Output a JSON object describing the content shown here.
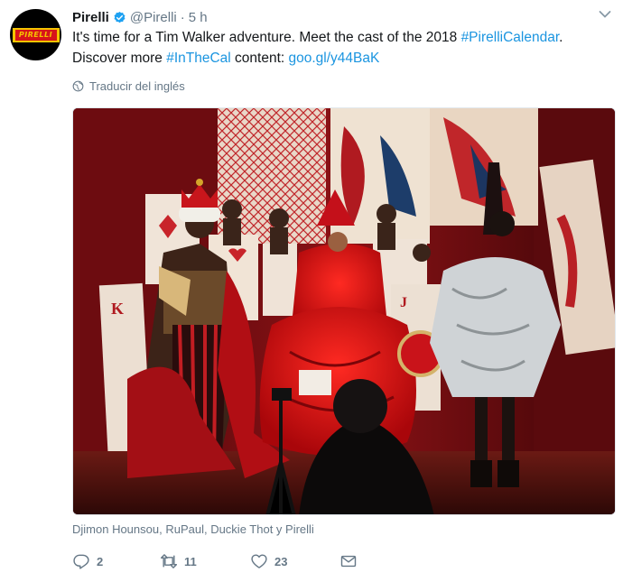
{
  "tweet": {
    "display_name": "Pirelli",
    "handle": "@Pirelli",
    "separator": "·",
    "time": "5 h",
    "avatar_text": "PIRELLI",
    "text_before": "It's time for a Tim Walker adventure. Meet the cast of the 2018 ",
    "hashtag_calendar": "#PirelliCalendar",
    "text_mid": ". Discover more ",
    "hashtag_inthecal": "#InTheCal",
    "text_after": " content: ",
    "short_link": "goo.gl/y44BaK",
    "translate_label": "Traducir del inglés",
    "photo_caption": "Djimon Hounsou, RuPaul, Duckie Thot y Pirelli"
  },
  "actions": {
    "reply_count": "2",
    "retweet_count": "11",
    "like_count": "23"
  },
  "colors": {
    "link": "#1b95e0",
    "muted": "#657786",
    "verified": "#1da1f2"
  },
  "icons": {
    "verified": "verified-badge-icon",
    "menu": "chevron-down-icon",
    "translate": "globe-icon",
    "reply": "reply-icon",
    "retweet": "retweet-icon",
    "like": "heart-icon",
    "message": "envelope-icon"
  }
}
